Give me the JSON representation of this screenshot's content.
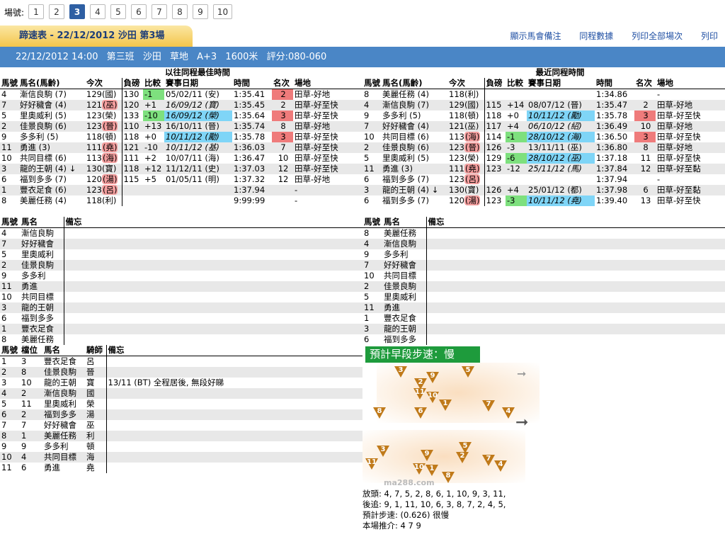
{
  "race_selector": {
    "label": "場號:",
    "races": [
      "1",
      "2",
      "3",
      "4",
      "5",
      "6",
      "7",
      "8",
      "9",
      "10"
    ],
    "active": "3"
  },
  "title": "蹄速表 - 22/12/2012  沙田  第3場",
  "links": [
    "顯示馬會備注",
    "同程數據",
    "列印全部場次",
    "列印"
  ],
  "info": {
    "datetime": "22/12/2012 14:00",
    "class": "第三班",
    "venue": "沙田",
    "track": "草地",
    "course": "A+3",
    "distance": "1600米",
    "rating": "評分:080-060"
  },
  "best": {
    "group": "以往同程最佳時間",
    "headers": [
      "馬號",
      "馬名(馬齡)",
      "今次",
      "負磅",
      "比較",
      "賽事日期",
      "時間",
      "名次",
      "場地"
    ],
    "rows": [
      [
        "4",
        "漸信良駒 (7)",
        "129(國)",
        "130",
        "-1",
        "05/02/11 (安)",
        "1:35.41",
        "2",
        "田草-好地"
      ],
      [
        "7",
        "好好穢會 (4)",
        "121(巫)",
        "120",
        "+1",
        "16/09/12 (寶)",
        "1:35.45",
        "2",
        "田草-好至快"
      ],
      [
        "5",
        "里奧威利 (5)",
        "123(榮)",
        "133",
        "-10",
        "16/09/12 (榮)",
        "1:35.64",
        "3",
        "田草-好至快"
      ],
      [
        "2",
        "佳景良駒 (6)",
        "123(晉)",
        "110",
        "+13",
        "16/10/11 (晉)",
        "1:35.74",
        "8",
        "田草-好地"
      ],
      [
        "9",
        "多多利 (5)",
        "118(頓)",
        "118",
        "+0",
        "10/11/12 (勵)",
        "1:35.78",
        "3",
        "田草-好至快"
      ],
      [
        "11",
        "勇進 (3)",
        "111(堯)",
        "121",
        "-10",
        "10/11/12 (基)",
        "1:36.03",
        "7",
        "田草-好至快"
      ],
      [
        "10",
        "共同目標 (6)",
        "113(海)",
        "111",
        "+2",
        "10/07/11 (海)",
        "1:36.47",
        "10",
        "田草-好至快"
      ],
      [
        "3",
        "龍的王朝 (4) ↓",
        "130(寶)",
        "118",
        "+12",
        "11/12/11 (史)",
        "1:37.03",
        "12",
        "田草-好至快"
      ],
      [
        "6",
        "福到多多 (7)",
        "120(湯)",
        "115",
        "+5",
        "01/05/11 (明)",
        "1:37.32",
        "12",
        "田草-好地"
      ],
      [
        "1",
        "豐衣足食 (6)",
        "123(呂)",
        "",
        "",
        "",
        "1:37.94",
        "",
        "-"
      ],
      [
        "8",
        "美麗任務 (4)",
        "118(利)",
        "",
        "",
        "",
        "9:99:99",
        "",
        "-"
      ]
    ]
  },
  "recent": {
    "group": "最近同程時間",
    "headers": [
      "馬號",
      "馬名(馬齡)",
      "今次",
      "負磅",
      "比較",
      "賽事日期",
      "時間",
      "名次",
      "場地"
    ],
    "rows": [
      [
        "8",
        "美麗任務 (4)",
        "118(利)",
        "",
        "",
        "",
        "1:34.86",
        "",
        "-"
      ],
      [
        "4",
        "漸信良駒 (7)",
        "129(國)",
        "115",
        "+14",
        "08/07/12 (晉)",
        "1:35.47",
        "2",
        "田草-好地"
      ],
      [
        "9",
        "多多利 (5)",
        "118(頓)",
        "118",
        "+0",
        "10/11/12 (勵)",
        "1:35.78",
        "3",
        "田草-好至快"
      ],
      [
        "7",
        "好好穢會 (4)",
        "121(巫)",
        "117",
        "+4",
        "06/10/12 (紹)",
        "1:36.49",
        "10",
        "田草-好地"
      ],
      [
        "10",
        "共同目標 (6)",
        "113(海)",
        "114",
        "-1",
        "28/10/12 (海)",
        "1:36.50",
        "3",
        "田草-好至快"
      ],
      [
        "2",
        "佳景良駒 (6)",
        "123(晉)",
        "126",
        "-3",
        "13/11/11 (巫)",
        "1:36.80",
        "8",
        "田草-好地"
      ],
      [
        "5",
        "里奧威利 (5)",
        "123(榮)",
        "129",
        "-6",
        "28/10/12 (巫)",
        "1:37.18",
        "11",
        "田草-好至快"
      ],
      [
        "11",
        "勇進 (3)",
        "111(堯)",
        "123",
        "-12",
        "25/11/12 (馬)",
        "1:37.84",
        "12",
        "田草-好至黏"
      ],
      [
        "6",
        "福到多多 (7)",
        "123(呂)",
        "",
        "",
        "",
        "1:37.94",
        "",
        "-"
      ],
      [
        "3",
        "龍的王朝 (4) ↓",
        "130(寶)",
        "126",
        "+4",
        "25/01/12 (都)",
        "1:37.98",
        "6",
        "田草-好至黏"
      ],
      [
        "6",
        "福到多多 (7)",
        "120(湯)",
        "123",
        "-3",
        "10/11/12 (堯)",
        "1:39.40",
        "13",
        "田草-好至快"
      ]
    ]
  },
  "notes_left": {
    "headers": [
      "馬號",
      "馬名",
      "備忘"
    ],
    "rows": [
      [
        "4",
        "漸信良駒"
      ],
      [
        "7",
        "好好穢會"
      ],
      [
        "5",
        "里奧威利"
      ],
      [
        "2",
        "佳景良駒"
      ],
      [
        "9",
        "多多利"
      ],
      [
        "11",
        "勇進"
      ],
      [
        "10",
        "共同目標"
      ],
      [
        "3",
        "龍的王朝"
      ],
      [
        "6",
        "福到多多"
      ],
      [
        "1",
        "豐衣足食"
      ],
      [
        "8",
        "美麗任務"
      ]
    ]
  },
  "notes_right": {
    "headers": [
      "馬號",
      "馬名",
      "備忘"
    ],
    "rows": [
      [
        "8",
        "美麗任務"
      ],
      [
        "4",
        "漸信良駒"
      ],
      [
        "9",
        "多多利"
      ],
      [
        "7",
        "好好穢會"
      ],
      [
        "10",
        "共同目標"
      ],
      [
        "2",
        "佳景良駒"
      ],
      [
        "5",
        "里奧威利"
      ],
      [
        "11",
        "勇進"
      ],
      [
        "1",
        "豐衣足食"
      ],
      [
        "3",
        "龍的王朝"
      ],
      [
        "6",
        "福到多多"
      ]
    ]
  },
  "draw": {
    "headers": [
      "馬號",
      "檔位",
      "馬名",
      "騎師",
      "備忘"
    ],
    "rows": [
      [
        "1",
        "3",
        "豐衣足食",
        "呂",
        ""
      ],
      [
        "2",
        "8",
        "佳景良駒",
        "晉",
        ""
      ],
      [
        "3",
        "10",
        "龍的王朝",
        "寶",
        "13/11 (BT) 全程居後, 無段好睇"
      ],
      [
        "4",
        "2",
        "漸信良駒",
        "國",
        ""
      ],
      [
        "5",
        "11",
        "里奧威利",
        "榮",
        ""
      ],
      [
        "6",
        "2",
        "福到多多",
        "湯",
        ""
      ],
      [
        "7",
        "7",
        "好好穢會",
        "巫",
        ""
      ],
      [
        "8",
        "1",
        "美麗任務",
        "利",
        ""
      ],
      [
        "9",
        "9",
        "多多利",
        "頓",
        ""
      ],
      [
        "10",
        "4",
        "共同目標",
        "海",
        ""
      ],
      [
        "11",
        "6",
        "勇進",
        "堯",
        ""
      ]
    ]
  },
  "pace": {
    "title": "預計早段步速：慢",
    "watermark": "ma288.com",
    "front_markers": [
      "3",
      "5",
      "9",
      "2",
      "11",
      "10",
      "1",
      "7",
      "8",
      "6",
      "4"
    ],
    "back_markers": [
      "3",
      "9",
      "5",
      "2",
      "7",
      "11",
      "10",
      "1",
      "4",
      "8"
    ],
    "summary": [
      "放頭: 4, 7, 5, 2, 8, 6, 1, 10, 9, 3, 11,",
      "後追: 9, 1, 11, 10, 6, 3, 8, 7, 2, 4, 5,",
      "預計步速: (0.626) 很慢",
      "本場推介: 4  7  9"
    ]
  }
}
